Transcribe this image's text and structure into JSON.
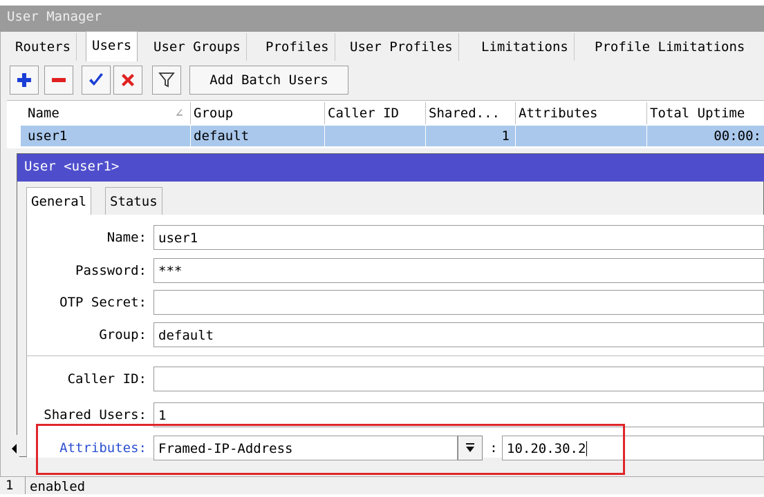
{
  "window": {
    "title": "User Manager"
  },
  "tabs": [
    {
      "label": "Routers"
    },
    {
      "label": "Users"
    },
    {
      "label": "User Groups"
    },
    {
      "label": "Profiles"
    },
    {
      "label": "User Profiles"
    },
    {
      "label": "Limitations"
    },
    {
      "label": "Profile Limitations"
    }
  ],
  "toolbar": {
    "add_icon": "plus-icon",
    "remove_icon": "minus-icon",
    "enable_icon": "checkmark-icon",
    "disable_icon": "cross-icon",
    "filter_icon": "filter-icon",
    "batch_label": "Add Batch Users"
  },
  "table": {
    "columns": [
      "Name",
      "Group",
      "Caller ID",
      "Shared...",
      "Attributes",
      "Total Uptime"
    ],
    "rows": [
      {
        "name": "user1",
        "group": "default",
        "caller_id": "",
        "shared": "1",
        "attributes": "",
        "uptime": "00:00:"
      }
    ]
  },
  "dialog": {
    "title": "User <user1>",
    "tabs": [
      "General",
      "Status"
    ],
    "fields": {
      "name_label": "Name:",
      "name_value": "user1",
      "password_label": "Password:",
      "password_value": "***",
      "otp_label": "OTP Secret:",
      "otp_value": "",
      "group_label": "Group:",
      "group_value": "default",
      "caller_label": "Caller ID:",
      "caller_value": "",
      "shared_label": "Shared Users:",
      "shared_value": "1",
      "attr_label": "Attributes:",
      "attr_name": "Framed-IP-Address",
      "attr_sep": ":",
      "attr_value": "10.20.30.2"
    }
  },
  "status": {
    "count": "1",
    "text": "enabled"
  },
  "colors": {
    "dialog_title": "#4e4ecd",
    "selection": "#a9c8ec",
    "highlight": "#e0262a",
    "attr_label": "#2a4fd0"
  }
}
